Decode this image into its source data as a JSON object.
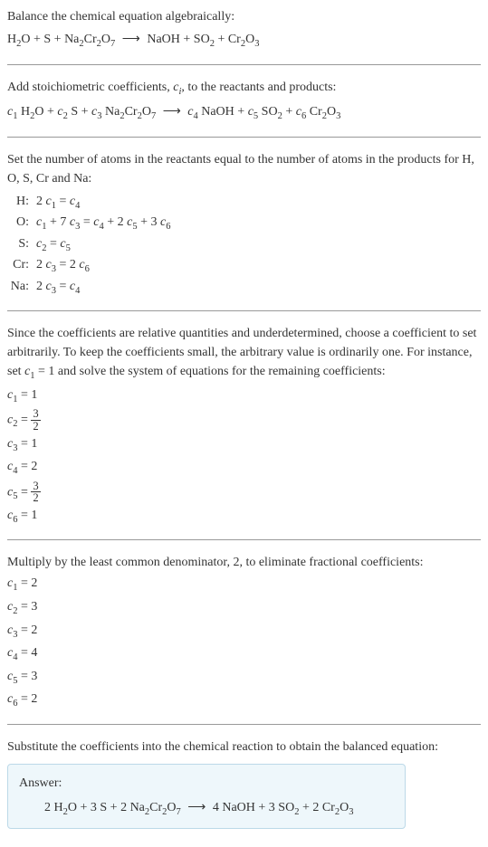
{
  "intro": {
    "line1": "Balance the chemical equation algebraically:",
    "eq": "H₂O + S + Na₂Cr₂O₇ ⟶ NaOH + SO₂ + Cr₂O₃"
  },
  "step1": {
    "text": "Add stoichiometric coefficients, cᵢ, to the reactants and products:",
    "eq": "c₁ H₂O + c₂ S + c₃ Na₂Cr₂O₇ ⟶ c₄ NaOH + c₅ SO₂ + c₆ Cr₂O₃"
  },
  "step2": {
    "text": "Set the number of atoms in the reactants equal to the number of atoms in the products for H, O, S, Cr and Na:",
    "rows": [
      {
        "label": "H:",
        "eq": "2 c₁ = c₄"
      },
      {
        "label": "O:",
        "eq": "c₁ + 7 c₃ = c₄ + 2 c₅ + 3 c₆"
      },
      {
        "label": "S:",
        "eq": "c₂ = c₅"
      },
      {
        "label": "Cr:",
        "eq": "2 c₃ = 2 c₆"
      },
      {
        "label": "Na:",
        "eq": "2 c₃ = c₄"
      }
    ]
  },
  "step3": {
    "text": "Since the coefficients are relative quantities and underdetermined, choose a coefficient to set arbitrarily. To keep the coefficients small, the arbitrary value is ordinarily one. For instance, set c₁ = 1 and solve the system of equations for the remaining coefficients:",
    "coeffs": [
      {
        "lhs": "c₁",
        "rhs": "1",
        "frac": false
      },
      {
        "lhs": "c₂",
        "rhs": "3/2",
        "frac": true,
        "num": "3",
        "den": "2"
      },
      {
        "lhs": "c₃",
        "rhs": "1",
        "frac": false
      },
      {
        "lhs": "c₄",
        "rhs": "2",
        "frac": false
      },
      {
        "lhs": "c₅",
        "rhs": "3/2",
        "frac": true,
        "num": "3",
        "den": "2"
      },
      {
        "lhs": "c₆",
        "rhs": "1",
        "frac": false
      }
    ]
  },
  "step4": {
    "text": "Multiply by the least common denominator, 2, to eliminate fractional coefficients:",
    "coeffs": [
      {
        "lhs": "c₁",
        "rhs": "2"
      },
      {
        "lhs": "c₂",
        "rhs": "3"
      },
      {
        "lhs": "c₃",
        "rhs": "2"
      },
      {
        "lhs": "c₄",
        "rhs": "4"
      },
      {
        "lhs": "c₅",
        "rhs": "3"
      },
      {
        "lhs": "c₆",
        "rhs": "2"
      }
    ]
  },
  "step5": {
    "text": "Substitute the coefficients into the chemical reaction to obtain the balanced equation:"
  },
  "answer": {
    "label": "Answer:",
    "eq": "2 H₂O + 3 S + 2 Na₂Cr₂O₇ ⟶ 4 NaOH + 3 SO₂ + 2 Cr₂O₃"
  }
}
